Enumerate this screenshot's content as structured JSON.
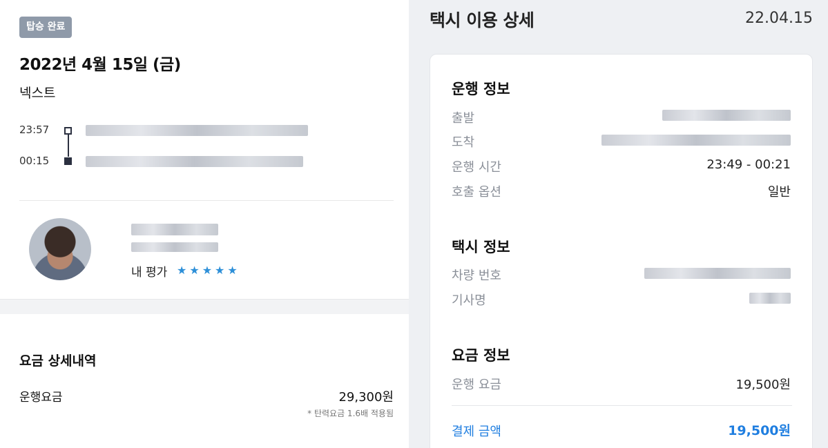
{
  "left": {
    "status_badge": "탑승 완료",
    "ride_date": "2022년 4월 15일 (금)",
    "service_name": "넥스트",
    "route": {
      "depart_time": "23:57",
      "arrive_time": "00:15"
    },
    "driver": {
      "rating_label": "내 평가",
      "stars": "★★★★★",
      "star_count": 5
    },
    "fare": {
      "title": "요금 상세내역",
      "label": "운행요금",
      "value": "29,300원",
      "note": "* 탄력요금 1.6배 적용됨"
    }
  },
  "right": {
    "title": "택시 이용 상세",
    "date": "22.04.15",
    "trip_info": {
      "section_title": "운행 정보",
      "depart_label": "출발",
      "arrive_label": "도착",
      "duration_label": "운행 시간",
      "duration_value": "23:49 - 00:21",
      "option_label": "호출 옵션",
      "option_value": "일반"
    },
    "taxi_info": {
      "section_title": "택시 정보",
      "plate_label": "차량 번호",
      "driver_label": "기사명"
    },
    "fare_info": {
      "section_title": "요금 정보",
      "fare_label": "운행 요금",
      "fare_value": "19,500원",
      "payment_label": "결제 금액",
      "payment_value": "19,500원"
    }
  },
  "colors": {
    "accent_blue": "#1f7ee0",
    "badge_gray": "#8f9aa9",
    "star_blue": "#2d8fd8"
  }
}
